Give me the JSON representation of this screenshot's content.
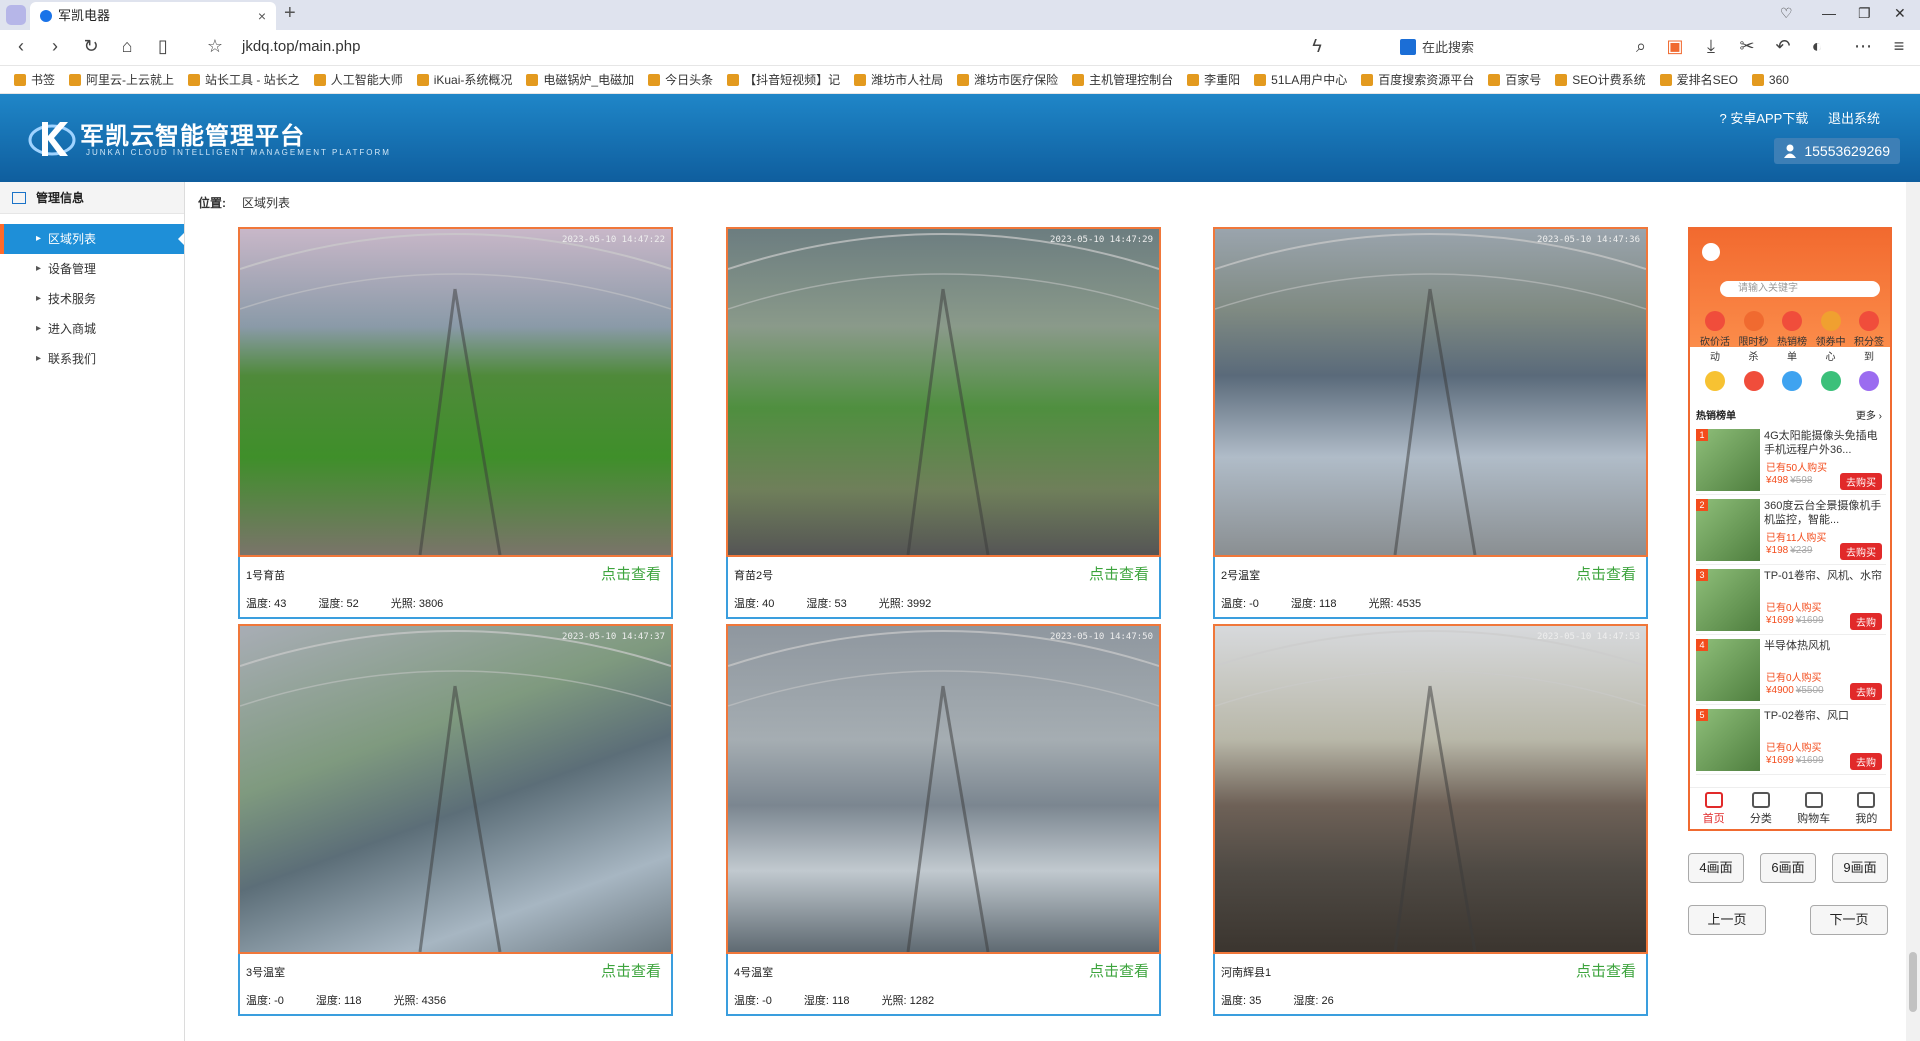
{
  "browser": {
    "tab_title": "军凯电器",
    "url": "jkdq.top/main.php",
    "search_placeholder": "在此搜索",
    "bookmarks": [
      "书签",
      "阿里云-上云就上",
      "站长工具 - 站长之",
      "人工智能大师",
      "iKuai-系统概况",
      "电磁锅炉_电磁加",
      "今日头条",
      "【抖音短视频】记",
      "潍坊市人社局",
      "潍坊市医疗保险",
      "主机管理控制台",
      "李重阳",
      "51LA用户中心",
      "百度搜索资源平台",
      "百家号",
      "SEO计费系统",
      "爱排名SEO",
      "360"
    ]
  },
  "header": {
    "title": "军凯云智能管理平台",
    "subtitle": "JUNKAI CLOUD INTELLIGENT MANAGEMENT PLATFORM",
    "app_download": "安卓APP下载",
    "logout": "退出系统",
    "user": "15553629269"
  },
  "sidebar": {
    "title": "管理信息",
    "items": [
      {
        "label": "区域列表"
      },
      {
        "label": "设备管理"
      },
      {
        "label": "技术服务"
      },
      {
        "label": "进入商城"
      },
      {
        "label": "联系我们"
      }
    ]
  },
  "breadcrumb": {
    "label": "位置:",
    "value": "区域列表"
  },
  "cameras": [
    {
      "name": "1号育苗",
      "timestamp": "2023-05-10 14:47:22",
      "view": "点击查看",
      "temp": "温度: 43",
      "hum": "湿度: 52",
      "light": "光照: 3806"
    },
    {
      "name": "育苗2号",
      "timestamp": "2023-05-10 14:47:29",
      "view": "点击查看",
      "temp": "温度: 40",
      "hum": "湿度: 53",
      "light": "光照: 3992"
    },
    {
      "name": "2号温室",
      "timestamp": "2023-05-10 14:47:36",
      "view": "点击查看",
      "temp": "温度: -0",
      "hum": "湿度: 118",
      "light": "光照: 4535"
    },
    {
      "name": "3号温室",
      "timestamp": "2023-05-10 14:47:37",
      "view": "点击查看",
      "temp": "温度: -0",
      "hum": "湿度: 118",
      "light": "光照: 4356"
    },
    {
      "name": "4号温室",
      "timestamp": "2023-05-10 14:47:50",
      "view": "点击查看",
      "temp": "温度: -0",
      "hum": "湿度: 118",
      "light": "光照: 1282"
    },
    {
      "name": "河南辉县1",
      "timestamp": "2023-05-10 14:47:53",
      "view": "点击查看",
      "temp": "温度: 35",
      "hum": "湿度: 26",
      "light": ""
    }
  ],
  "shop": {
    "search_placeholder": "请输入关键字",
    "cats": [
      "砍价活动",
      "限时秒杀",
      "热销榜单",
      "领券中心",
      "积分签到"
    ],
    "hot_title": "热销榜单",
    "more": "更多",
    "products": [
      {
        "rank": "1",
        "title": "4G太阳能摄像头免插电手机远程户外36...",
        "sold": "已有50人购买",
        "price": "¥498",
        "old": "¥598",
        "buy": "去购买"
      },
      {
        "rank": "2",
        "title": "360度云台全景摄像机手机监控，智能...",
        "sold": "已有11人购买",
        "price": "¥198",
        "old": "¥239",
        "buy": "去购买"
      },
      {
        "rank": "3",
        "title": "TP-01卷帘、风机、水帘",
        "sold": "已有0人购买",
        "price": "¥1699",
        "old": "¥1699",
        "buy": "去购"
      },
      {
        "rank": "4",
        "title": "半导体热风机",
        "sold": "已有0人购买",
        "price": "¥4900",
        "old": "¥5500",
        "buy": "去购"
      },
      {
        "rank": "5",
        "title": "TP-02卷帘、风口",
        "sold": "已有0人购买",
        "price": "¥1699",
        "old": "¥1699",
        "buy": "去购"
      }
    ],
    "nav": [
      "首页",
      "分类",
      "购物车",
      "我的"
    ]
  },
  "controls": {
    "four": "4画面",
    "six": "6画面",
    "nine": "9画面",
    "prev": "上一页",
    "next": "下一页"
  },
  "colors": {
    "header": "#1570b4",
    "accent": "#f0773a",
    "view": "#3da43d",
    "info_border": "#3a9ede"
  }
}
